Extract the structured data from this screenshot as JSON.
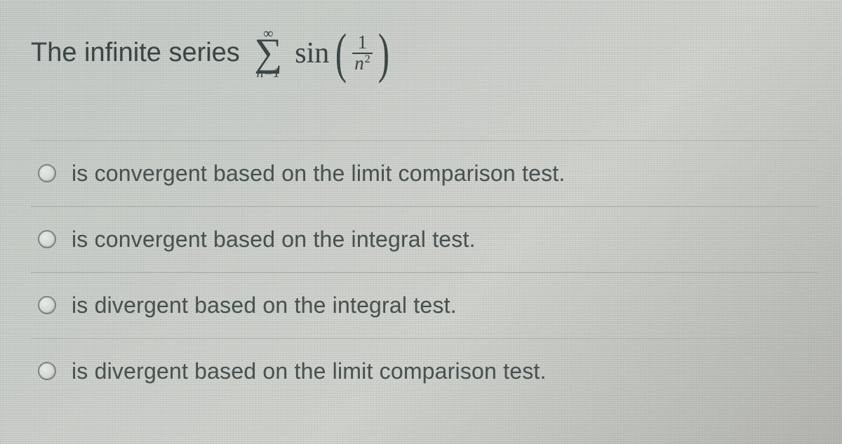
{
  "question": {
    "prefix": "The infinite series ",
    "sum_upper": "∞",
    "sum_lower": "n=1",
    "function": "sin",
    "frac_num": "1",
    "frac_den_base": "n",
    "frac_den_exp": "2"
  },
  "options": [
    {
      "label": "is convergent based on the limit comparison test."
    },
    {
      "label": "is convergent based on the integral test."
    },
    {
      "label": "is divergent based on the integral test."
    },
    {
      "label": "is divergent based on the limit comparison test."
    }
  ]
}
